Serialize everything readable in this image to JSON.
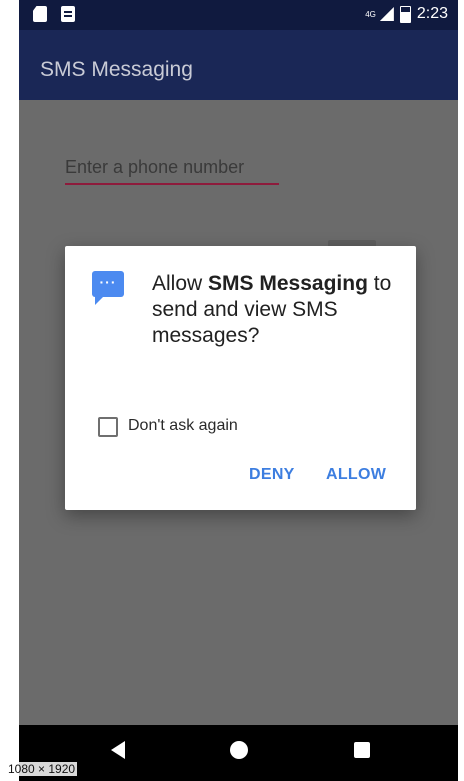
{
  "status_bar": {
    "network": "4G",
    "time": "2:23",
    "icons": [
      "sd-card-icon",
      "message-icon",
      "signal-icon",
      "battery-icon"
    ]
  },
  "app_bar": {
    "title": "SMS Messaging"
  },
  "form": {
    "phone_placeholder": "Enter a phone number"
  },
  "dialog": {
    "prompt_prefix": "Allow ",
    "prompt_app": "SMS Messaging",
    "prompt_suffix": " to send and view SMS messages?",
    "checkbox_label": "Don't ask again",
    "checkbox_checked": false,
    "deny_label": "DENY",
    "allow_label": "ALLOW",
    "icon": "chat-icon",
    "accent_color": "#3d7ee0"
  },
  "nav_bar": {
    "icons": [
      "back-icon",
      "home-icon",
      "recents-icon"
    ]
  },
  "overlay": {
    "resolution": "1080 × 1920"
  }
}
